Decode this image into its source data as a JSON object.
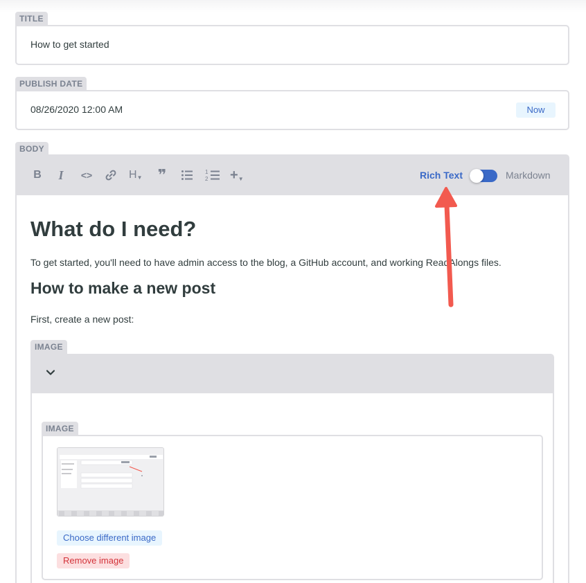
{
  "title_field": {
    "label": "TITLE",
    "value": "How to get started"
  },
  "publish_field": {
    "label": "PUBLISH DATE",
    "value": "08/26/2020 12:00 AM",
    "now_label": "Now"
  },
  "body_field": {
    "label": "BODY",
    "toolbar": {
      "bold": "B",
      "italic": "I",
      "code": "<>",
      "heading": "H",
      "quote": "❞",
      "add": "+",
      "rich_text_label": "Rich Text",
      "markdown_label": "Markdown"
    },
    "content": {
      "h1": "What do I need?",
      "p1": "To get started, you'll need to have admin access to the blog, a GitHub account, and working ReadAlongs files.",
      "h2": "How to make a new post",
      "p2": "First, create a new post:"
    },
    "image_widget": {
      "label": "IMAGE",
      "inner_label": "IMAGE",
      "choose_label": "Choose different image",
      "remove_label": "Remove image"
    }
  },
  "colors": {
    "accent": "#3a69c7",
    "label_bg": "#dfdfe3",
    "danger": "#d3333a",
    "annotation_arrow": "#f25a4f"
  }
}
